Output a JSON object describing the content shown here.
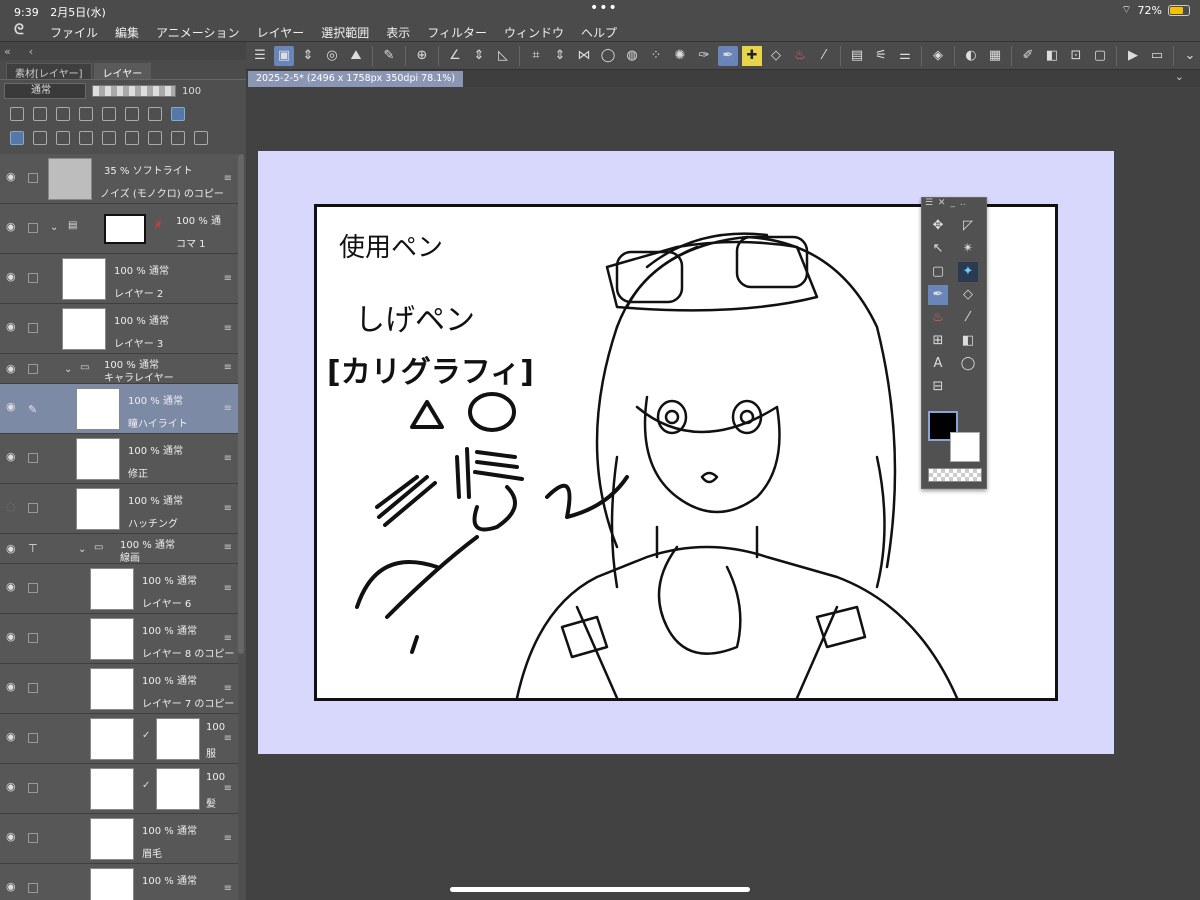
{
  "status": {
    "time": "9:39",
    "date": "2月5日(水)",
    "dots": "•••",
    "battery": "72%",
    "battery_fraction": 0.72
  },
  "menu": [
    "ファイル",
    "編集",
    "アニメーション",
    "レイヤー",
    "選択範囲",
    "表示",
    "フィルター",
    "ウィンドウ",
    "ヘルプ"
  ],
  "panel": {
    "tabs": [
      "素材[レイヤー]",
      "レイヤー"
    ],
    "blend_mode": "通常",
    "opacity": "100"
  },
  "doc": {
    "tab_title": "2025-2-5* (2496 x 1758px 350dpi 78.1%)"
  },
  "layers": [
    {
      "info": "35 % ソフトライト",
      "name": "ノイズ (モノクロ) のコピー"
    },
    {
      "info": "100 % 通",
      "name": "コマ 1"
    },
    {
      "info": "100 % 通常",
      "name": "レイヤー 2"
    },
    {
      "info": "100 % 通常",
      "name": "レイヤー 3"
    },
    {
      "info": "100 % 通常",
      "name": "キャラレイヤー"
    },
    {
      "info": "100 % 通常",
      "name": "瞳ハイライト"
    },
    {
      "info": "100 % 通常",
      "name": "修正"
    },
    {
      "info": "100 % 通常",
      "name": "ハッチング"
    },
    {
      "info": "100 % 通常",
      "name": "線画"
    },
    {
      "info": "100 % 通常",
      "name": "レイヤー 6"
    },
    {
      "info": "100 % 通常",
      "name": "レイヤー 8 のコピー"
    },
    {
      "info": "100 % 通常",
      "name": "レイヤー 7 のコピー"
    },
    {
      "info": "100",
      "name": "服"
    },
    {
      "info": "100",
      "name": "髪"
    },
    {
      "info": "100 % 通常",
      "name": "眉毛"
    },
    {
      "info": "100 % 通常",
      "name": ""
    }
  ],
  "artwork": {
    "line1": "使用ペン",
    "line2": "しげペン",
    "line3": "[カリグラフィ]"
  }
}
